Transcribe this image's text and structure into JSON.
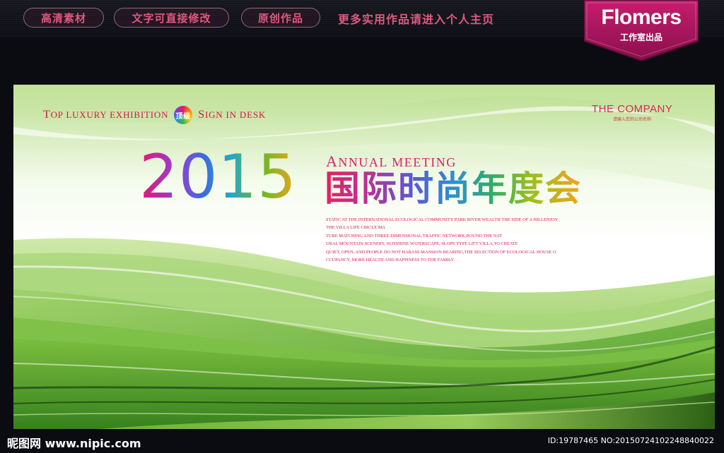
{
  "topbar": {
    "tags": [
      "高清素材",
      "文字可直接修改",
      "原创作品"
    ],
    "more_link": "更多实用作品请进入个人主页",
    "brand_name": "Flomers",
    "brand_sub": "工作室出品"
  },
  "banner": {
    "top_left_tag": {
      "part1_cap": "T",
      "part1": "OP LUXURY EXHIBITION",
      "badge": "顶级",
      "part2_cap": "S",
      "part2": "IGN IN DESK"
    },
    "company": "THE COMPANY",
    "company_sub": "请输入您的公司名称",
    "year": "2015",
    "annual_cap": "A",
    "annual": "NNUAL MEETING",
    "title_cn": "国际时尚年度会",
    "blurb": [
      "STATIC AT THE INTERNATIONAL ECOLOGICAL COMMUNITY PARK RIVER WEALTH THE SIDE OF A HILLENJOY",
      "THE VILLA LIFE CIRCLE MA",
      "TURE MATCHING AND THREE-DIMENSIONAL TRAFFIC NETWORK,ROUND THE NAT",
      "URAL MOUNTAIN SCENERY, SUNSHINE WATERSCAPE, SLOPE TYPE LIFT VILLA,TO CREATE",
      "QUIET, OPEN, AND PEOPLE DO NOT HARASS MANSION BEARING,THE SELECTION OF ECOLOGICAL HOUSE O",
      "CCUPANCY, MORE HEALTH AND HAPPINESS TO THE FAMILY."
    ]
  },
  "footer": {
    "logo": "昵图网 www.nipic.com",
    "id_text": "ID:19787465 NO:20150724102248840022"
  },
  "colors": {
    "accent_pink": "#e0587e",
    "brand_magenta": "#b0185e",
    "green": "#5fae2e",
    "background": "#0b0b12"
  }
}
